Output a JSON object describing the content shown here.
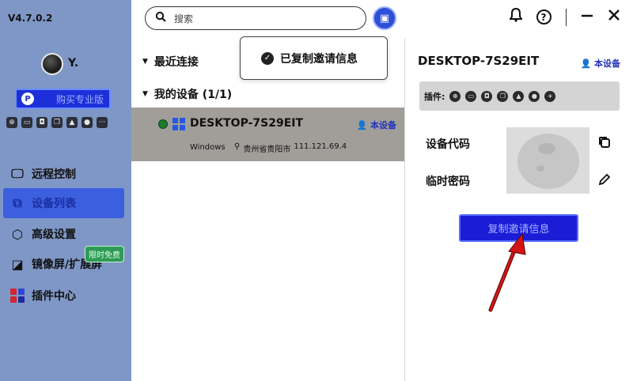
{
  "app": {
    "version": "V4.7.0.2"
  },
  "user": {
    "name": "Y."
  },
  "sidebar": {
    "buy_label": "购买专业版",
    "plugin_icons": [
      "gamepad-icon",
      "monitor-icon",
      "camera-icon",
      "window-icon",
      "rocket-icon",
      "circle-icon",
      "more-icon"
    ],
    "items": [
      {
        "label": "远程控制",
        "icon": "remote-control-icon"
      },
      {
        "label": "设备列表",
        "icon": "device-list-icon",
        "active": true
      },
      {
        "label": "高级设置",
        "icon": "settings-icon"
      },
      {
        "label": "镜像屏/扩展屏",
        "icon": "mirror-screen-icon",
        "badge": "限时免费"
      },
      {
        "label": "插件中心",
        "icon": "plugin-center-icon"
      }
    ]
  },
  "topbar": {
    "search_placeholder": "搜索"
  },
  "device_list": {
    "groups": [
      {
        "label": "最近连接"
      },
      {
        "label": "我的设备 (1/1)"
      }
    ],
    "devices": [
      {
        "name": "DESKTOP-7S29EIT",
        "tag": "本设备",
        "os": "Windows",
        "location": "贵州省贵阳市",
        "ip": "111.121.69.4",
        "status": "online"
      }
    ]
  },
  "toast": {
    "message": "已复制邀请信息"
  },
  "detail": {
    "title": "DESKTOP-7S29EIT",
    "tag": "本设备",
    "plugins_label": "插件:",
    "device_code_label": "设备代码",
    "temp_password_label": "临时密码",
    "copy_invite_label": "复制邀请信息"
  },
  "colors": {
    "sidebar_bg": "#7f97c6",
    "accent": "#1b1cd6",
    "online": "#1c7c2d",
    "selected_row": "#a19e9a",
    "annotation_arrow": "#d21414"
  }
}
